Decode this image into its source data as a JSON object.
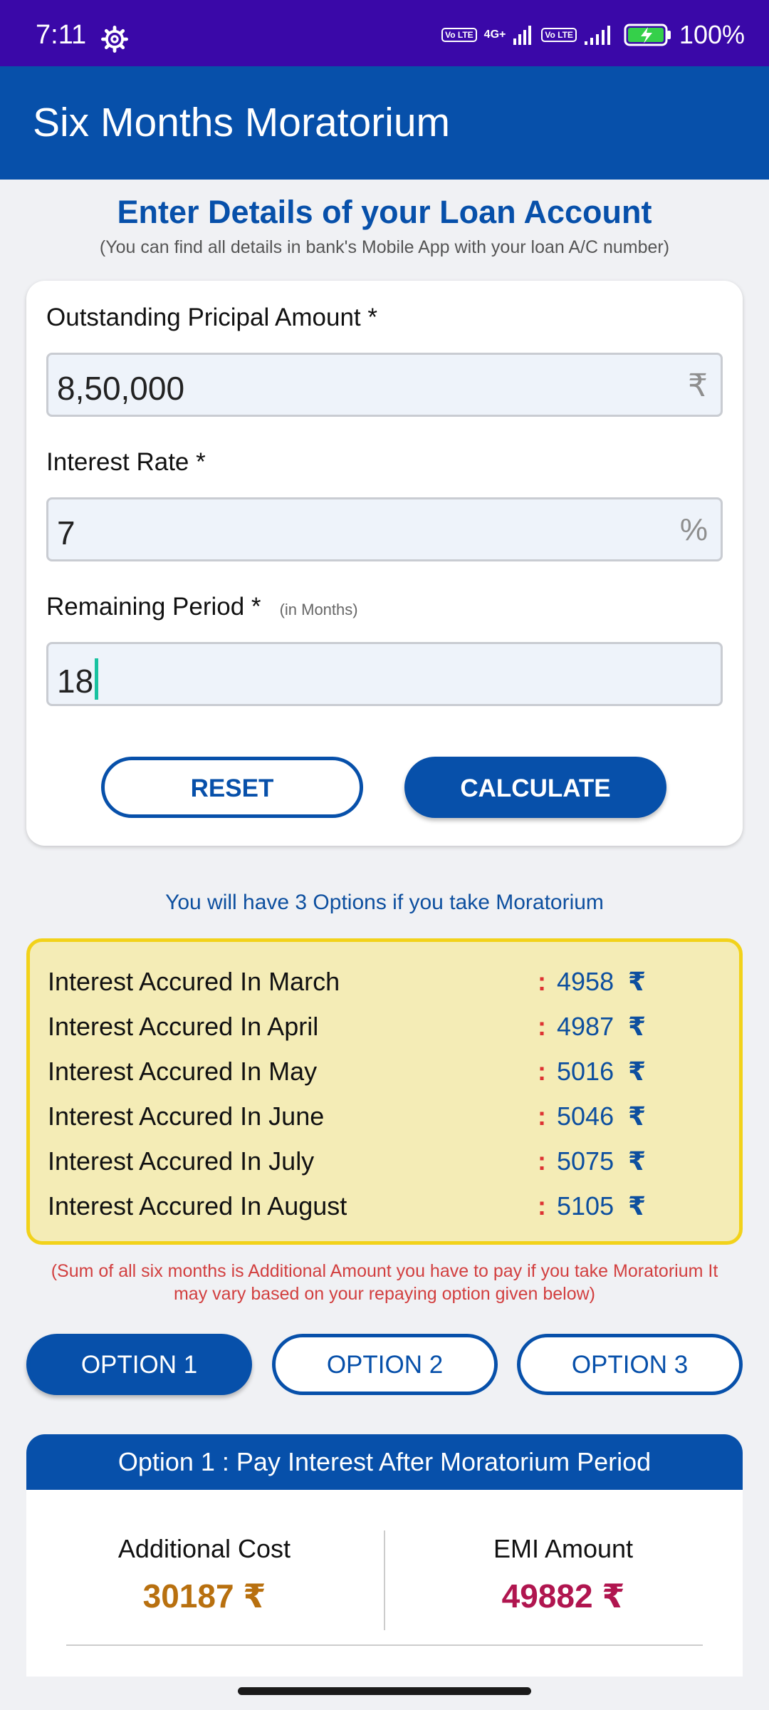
{
  "status": {
    "time": "7:11",
    "battery": "100%",
    "volte_label": "Vo LTE",
    "network_label": "4G+",
    "icons": [
      "gear-icon",
      "signal-icon",
      "battery-charging-icon"
    ]
  },
  "app_bar": {
    "title": "Six Months Moratorium"
  },
  "heading": {
    "title": "Enter Details of your Loan Account",
    "subtitle": "(You can find all details in bank's Mobile App with your loan A/C number)"
  },
  "form": {
    "principal": {
      "label": "Outstanding Pricipal Amount *",
      "value": "8,50,000",
      "suffix": "₹"
    },
    "rate": {
      "label": "Interest Rate *",
      "value": "7",
      "suffix": "%"
    },
    "period": {
      "label": "Remaining Period *",
      "hint": "(in Months)",
      "value": "18"
    },
    "reset_label": "RESET",
    "calculate_label": "CALCULATE"
  },
  "info_text": "You will have 3 Options if you take Moratorium",
  "interest": {
    "rows": [
      {
        "label": "Interest Accured In March",
        "value": "4958"
      },
      {
        "label": "Interest Accured In April",
        "value": "4987"
      },
      {
        "label": "Interest Accured In May",
        "value": "5016"
      },
      {
        "label": "Interest Accured In June",
        "value": "5046"
      },
      {
        "label": "Interest Accured In July",
        "value": "5075"
      },
      {
        "label": "Interest Accured In August",
        "value": "5105"
      }
    ],
    "colon": ":",
    "currency": "₹"
  },
  "note": "(Sum of all six months is Additional Amount you have to pay if you take Moratorium It may vary based on your repaying option given below)",
  "options": [
    {
      "label": "OPTION 1",
      "selected": true
    },
    {
      "label": "OPTION 2",
      "selected": false
    },
    {
      "label": "OPTION 3",
      "selected": false
    }
  ],
  "result": {
    "header": "Option 1 : Pay Interest After Moratorium Period",
    "additional_cost_label": "Additional Cost",
    "additional_cost_value": "30187  ₹",
    "emi_label": "EMI Amount",
    "emi_value": "49882  ₹"
  },
  "colors": {
    "status_bar": "#3a08a8",
    "primary": "#0750aa",
    "highlight_box": "#f4ecb6",
    "highlight_border": "#f2d21a",
    "note_red": "#d23f3f",
    "cost_orange": "#b8700f",
    "emi_crimson": "#b0154f"
  }
}
